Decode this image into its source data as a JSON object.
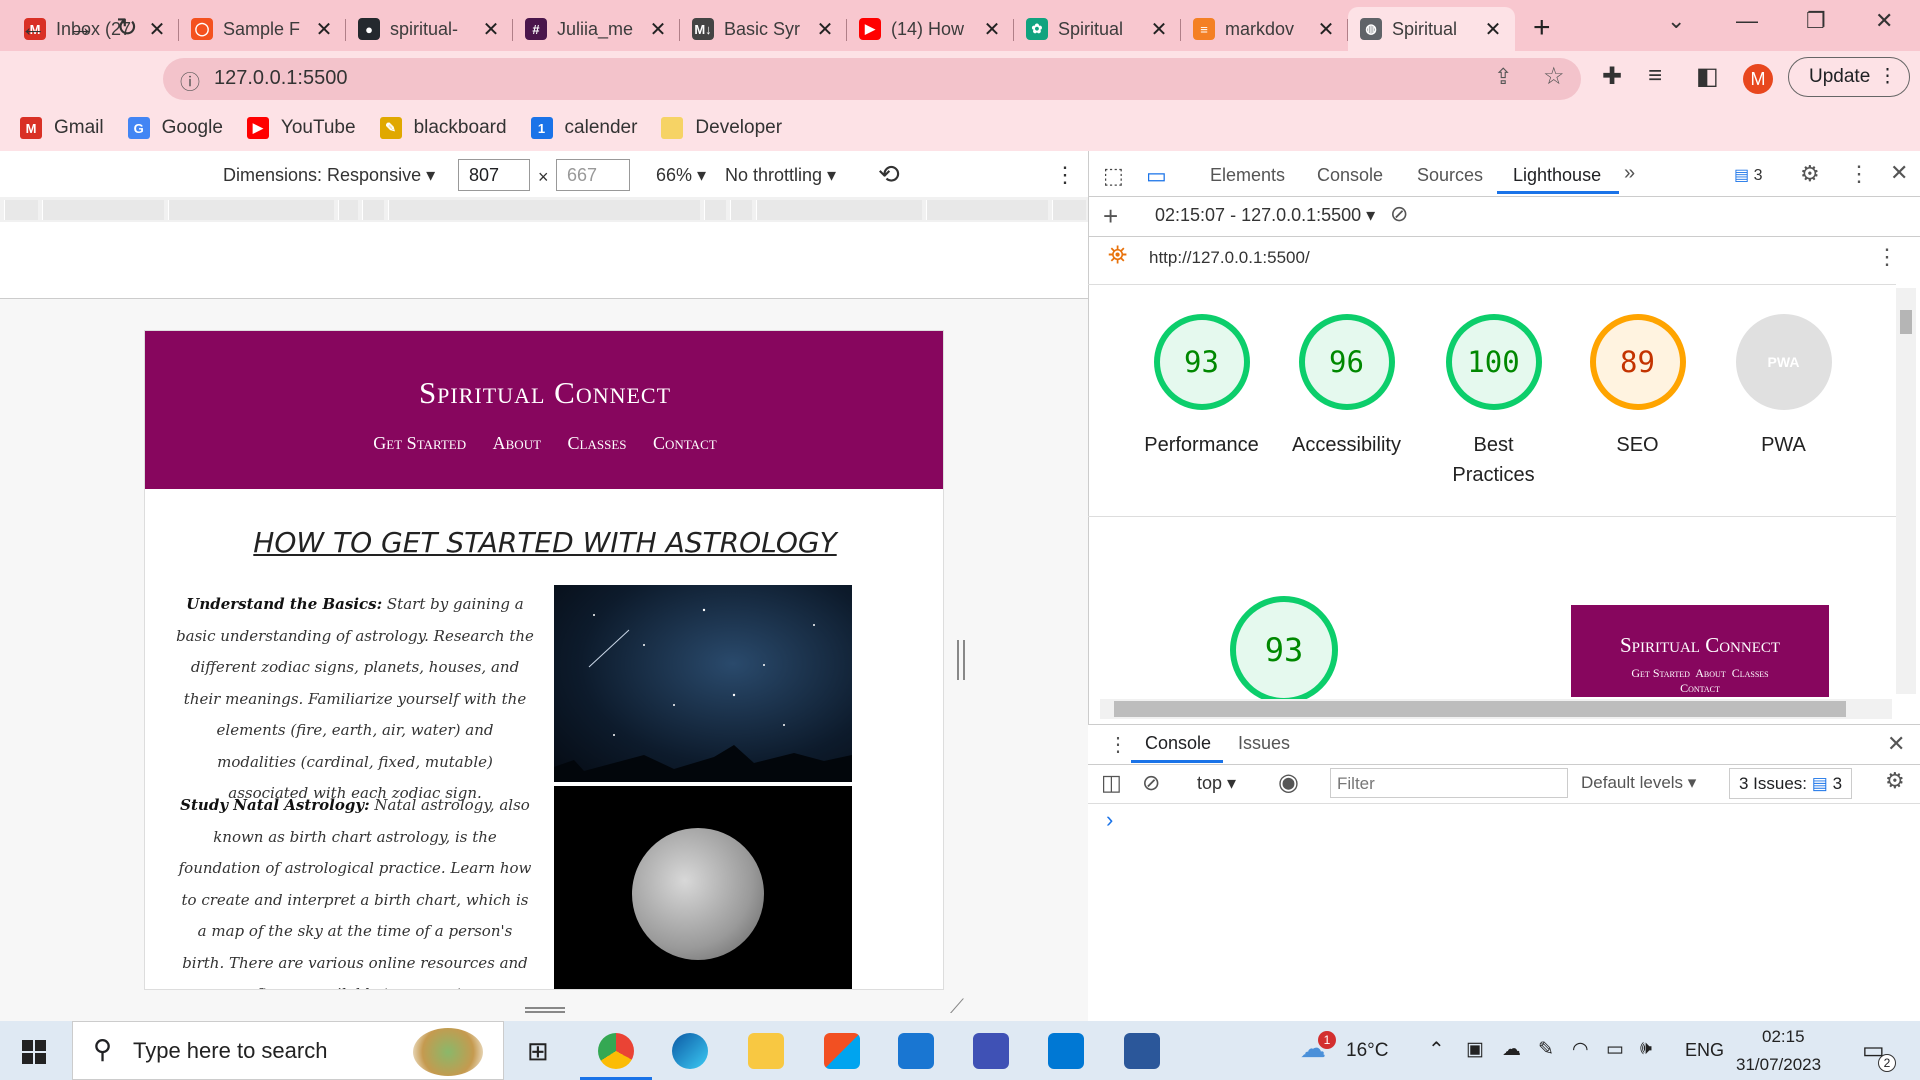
{
  "browser": {
    "tabs": [
      {
        "label": "Inbox (27",
        "icon": "gmail-icon",
        "color": "#d93025",
        "glyph": "M"
      },
      {
        "label": "Sample F",
        "icon": "circle-icon",
        "color": "#f4511e",
        "glyph": "◯"
      },
      {
        "label": "spiritual-",
        "icon": "github-icon",
        "color": "#24292e",
        "glyph": "●"
      },
      {
        "label": "Juliia_me",
        "icon": "slack-icon",
        "color": "#4a154b",
        "glyph": "#"
      },
      {
        "label": "Basic Syr",
        "icon": "markdown-icon",
        "color": "#444444",
        "glyph": "M↓"
      },
      {
        "label": "(14) How",
        "icon": "youtube-icon",
        "color": "#ff0000",
        "glyph": "▶"
      },
      {
        "label": "Spiritual",
        "icon": "chatgpt-icon",
        "color": "#10a37f",
        "glyph": "✿"
      },
      {
        "label": "markdov",
        "icon": "stackoverflow-icon",
        "color": "#f48024",
        "glyph": "≡"
      },
      {
        "label": "Spiritual",
        "icon": "globe-icon",
        "color": "#5f6368",
        "glyph": "◍",
        "active": true
      }
    ],
    "url": "127.0.0.1:5500",
    "update_label": "Update",
    "profile_initial": "M",
    "bookmarks": [
      {
        "label": "Gmail",
        "icon": "gmail-icon",
        "color": "#d93025",
        "glyph": "M"
      },
      {
        "label": "Google",
        "icon": "google-icon",
        "color": "#4285f4",
        "glyph": "G"
      },
      {
        "label": "YouTube",
        "icon": "youtube-icon",
        "color": "#ff0000",
        "glyph": "▶"
      },
      {
        "label": "blackboard",
        "icon": "blackboard-icon",
        "color": "#e0a800",
        "glyph": "✎"
      },
      {
        "label": "calender",
        "icon": "calendar-icon",
        "color": "#1a73e8",
        "glyph": "1"
      },
      {
        "label": "Developer",
        "icon": "folder-icon",
        "color": "#f6d365",
        "glyph": ""
      }
    ]
  },
  "device_toolbar": {
    "dimensions_label": "Dimensions: Responsive ▾",
    "width": "807",
    "height_placeholder": "667",
    "zoom": "66% ▾",
    "throttle": "No throttling ▾"
  },
  "site": {
    "title": "Spiritual Connect",
    "nav": [
      "Get Started",
      "About",
      "Classes",
      "Contact"
    ],
    "article_title": "HOW TO GET STARTED WITH ASTROLOGY",
    "para1_head": "Understand the Basics:",
    "para1_body": " Start by gaining a basic understanding of astrology. Research the different zodiac signs, planets, houses, and their meanings. Familiarize yourself with the elements (fire, earth, air, water) and modalities (cardinal, fixed, mutable) associated with each zodiac sign.",
    "para2_head": "Study Natal Astrology:",
    "para2_body": " Natal astrology, also known as birth chart astrology, is the foundation of astrological practice. Learn how to create and interpret a birth chart, which is a map of the sky at the time of a person's birth. There are various online resources and software available to generate"
  },
  "devtools": {
    "tabs": [
      "Elements",
      "Console",
      "Sources",
      "Lighthouse"
    ],
    "active_tab": "Lighthouse",
    "issues_badge": "3",
    "report_label": "02:15:07 - 127.0.0.1:5500 ▾",
    "report_url": "http://127.0.0.1:5500/",
    "scores": [
      {
        "value": "93",
        "label": "Performance",
        "status": "green"
      },
      {
        "value": "96",
        "label": "Accessibility",
        "status": "green"
      },
      {
        "value": "100",
        "label": "Best Practices",
        "status": "green"
      },
      {
        "value": "89",
        "label": "SEO",
        "status": "orange"
      },
      {
        "value": "PWA",
        "label": "PWA",
        "status": "grey"
      }
    ],
    "detail_score": "93",
    "preview_title": "Spiritual Connect",
    "preview_nav": "Get Started  About  Classes",
    "preview_nav2": "Contact",
    "drawer_tabs": [
      "Console",
      "Issues"
    ],
    "context": "top ▾",
    "filter_placeholder": "Filter",
    "levels": "Default levels ▾",
    "issues_label": "3 Issues:",
    "issues_count": "3",
    "prompt": "›"
  },
  "taskbar": {
    "search_placeholder": "Type here to search",
    "weather": "16°C",
    "weather_badge": "1",
    "lang": "ENG",
    "time": "02:15",
    "date": "31/07/2023",
    "notif_count": "2"
  }
}
